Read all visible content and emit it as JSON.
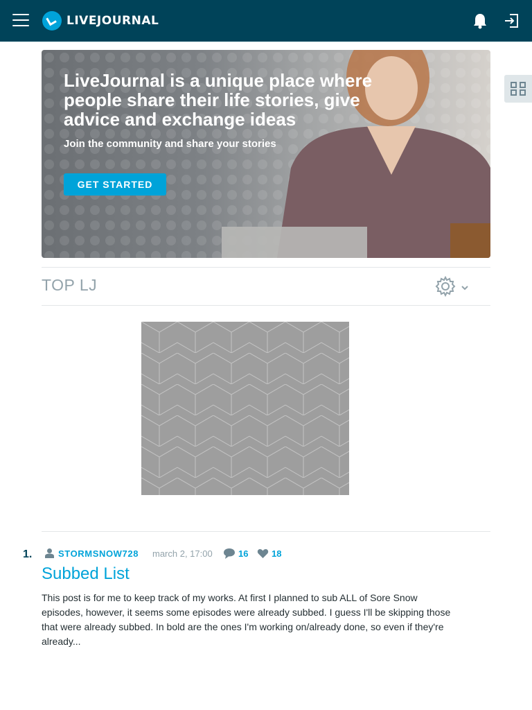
{
  "header": {
    "logo_text": "LIVEJOURNAL"
  },
  "hero": {
    "title": "LiveJournal is a unique place where people share their life stories, give advice and exchange ideas",
    "subtitle": "Join the community and share your stories",
    "cta_label": "GET STARTED"
  },
  "top_section": {
    "title": "TOP LJ"
  },
  "posts": [
    {
      "rank": "1.",
      "author": "STORMSNOW728",
      "date": "march 2, 17:00",
      "comments": "16",
      "likes": "18",
      "title": "Subbed List",
      "excerpt": "This post is for me to keep track of my works. At first I planned to sub ALL of Sore Snow episodes, however, it seems some episodes were already subbed. I guess I'll be skipping those that were already subbed. In bold are the ones I'm working on/already done, so even if they're already..."
    }
  ],
  "colors": {
    "header_bg": "#004359",
    "accent": "#00a3d9",
    "muted": "#93a3ab"
  },
  "icons": [
    "menu-icon",
    "livejournal-logo-icon",
    "bell-icon",
    "login-icon",
    "widgets-icon",
    "gear-icon",
    "chevron-down-icon",
    "user-icon",
    "comment-icon",
    "heart-icon"
  ]
}
